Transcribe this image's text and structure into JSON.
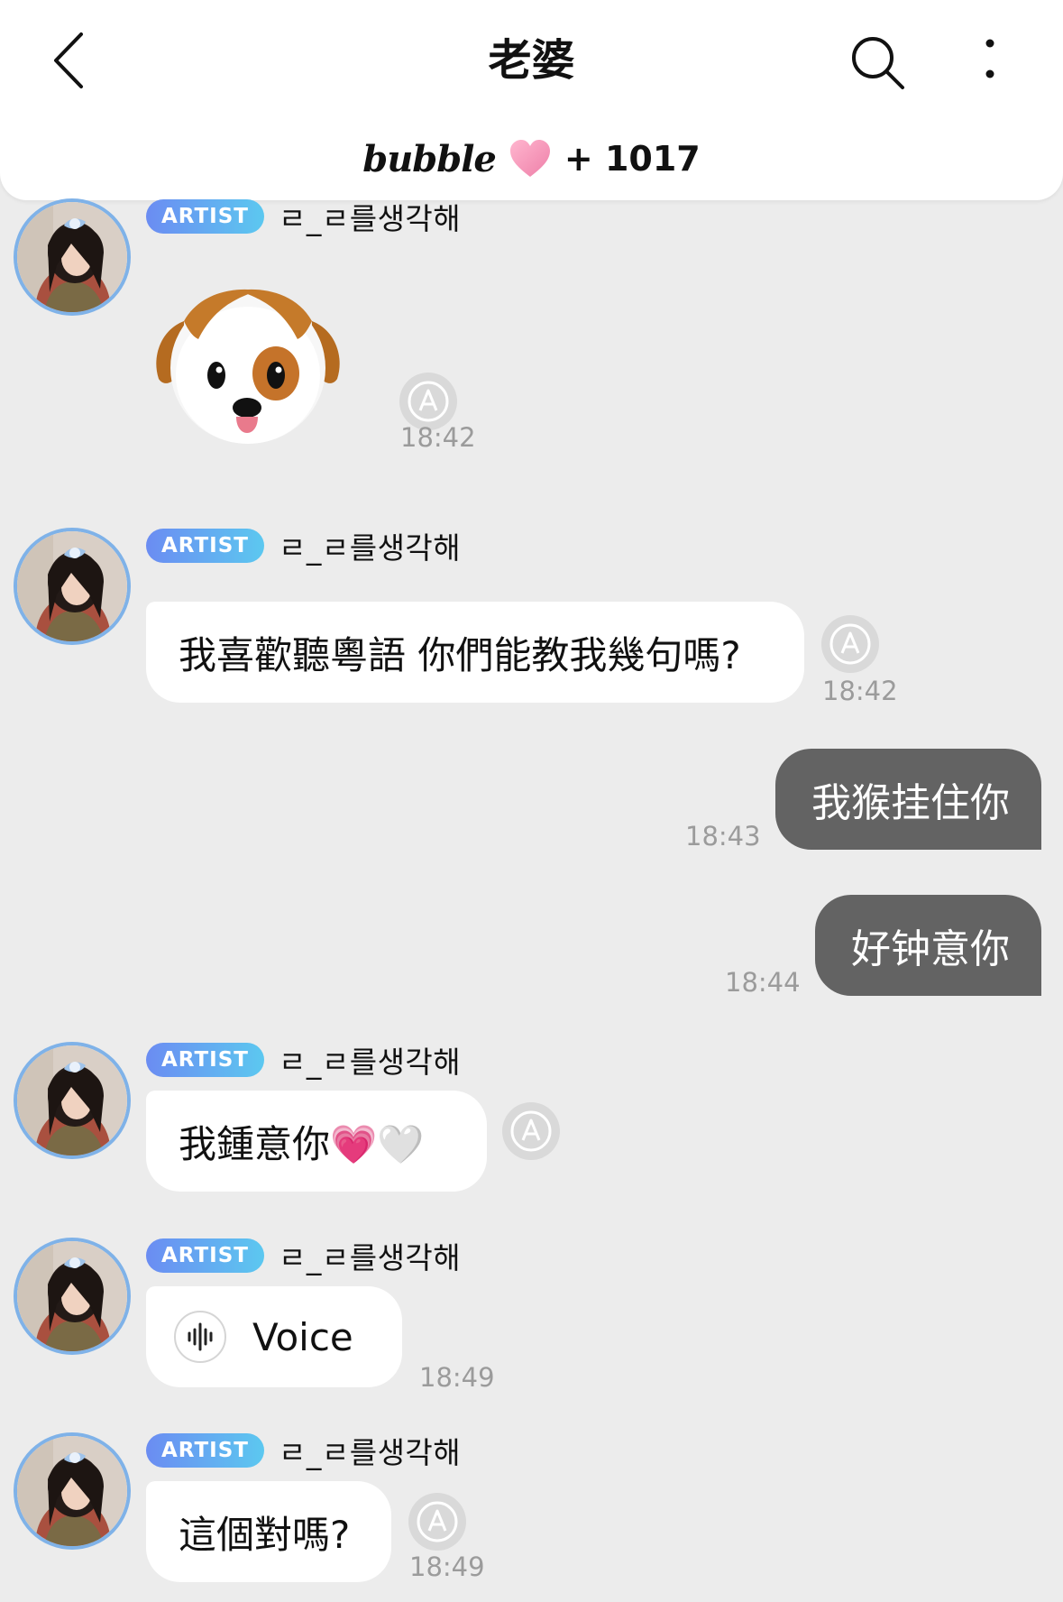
{
  "header": {
    "title": "老婆",
    "brand": "bubble",
    "count": "+ 1017"
  },
  "sender": {
    "badge": "ARTIST",
    "name": "ㄹ_ㄹ를생각해"
  },
  "messages": [
    {
      "type": "emoji",
      "emoji": "dog-face-emoji",
      "time": "18:42",
      "translatable": true
    },
    {
      "type": "text",
      "text": "我喜歡聽粵語 你們能教我幾句嗎?",
      "time": "18:42",
      "translatable": true
    },
    {
      "type": "outgoing",
      "text": "我猴挂住你",
      "time": "18:43"
    },
    {
      "type": "outgoing",
      "text": "好钟意你",
      "time": "18:44"
    },
    {
      "type": "text",
      "text": "我鍾意你💗🤍",
      "translatable": true
    },
    {
      "type": "voice",
      "label": "Voice",
      "time": "18:49"
    },
    {
      "type": "text",
      "text": "這個對嗎?",
      "time": "18:49",
      "translatable": true
    }
  ],
  "colors": {
    "background": "#ececec",
    "outgoing_bubble": "#636363",
    "badge_start": "#6b8cf2",
    "badge_end": "#5cc8f0",
    "avatar_ring": "#7fb2e8",
    "brand_heart": "#f28bb0"
  },
  "icons": {
    "back": "chevron-left-icon",
    "search": "search-icon",
    "more": "more-vertical-icon",
    "translate": "translate-icon",
    "voice": "voice-waveform-icon",
    "brand_heart": "heart-icon"
  }
}
